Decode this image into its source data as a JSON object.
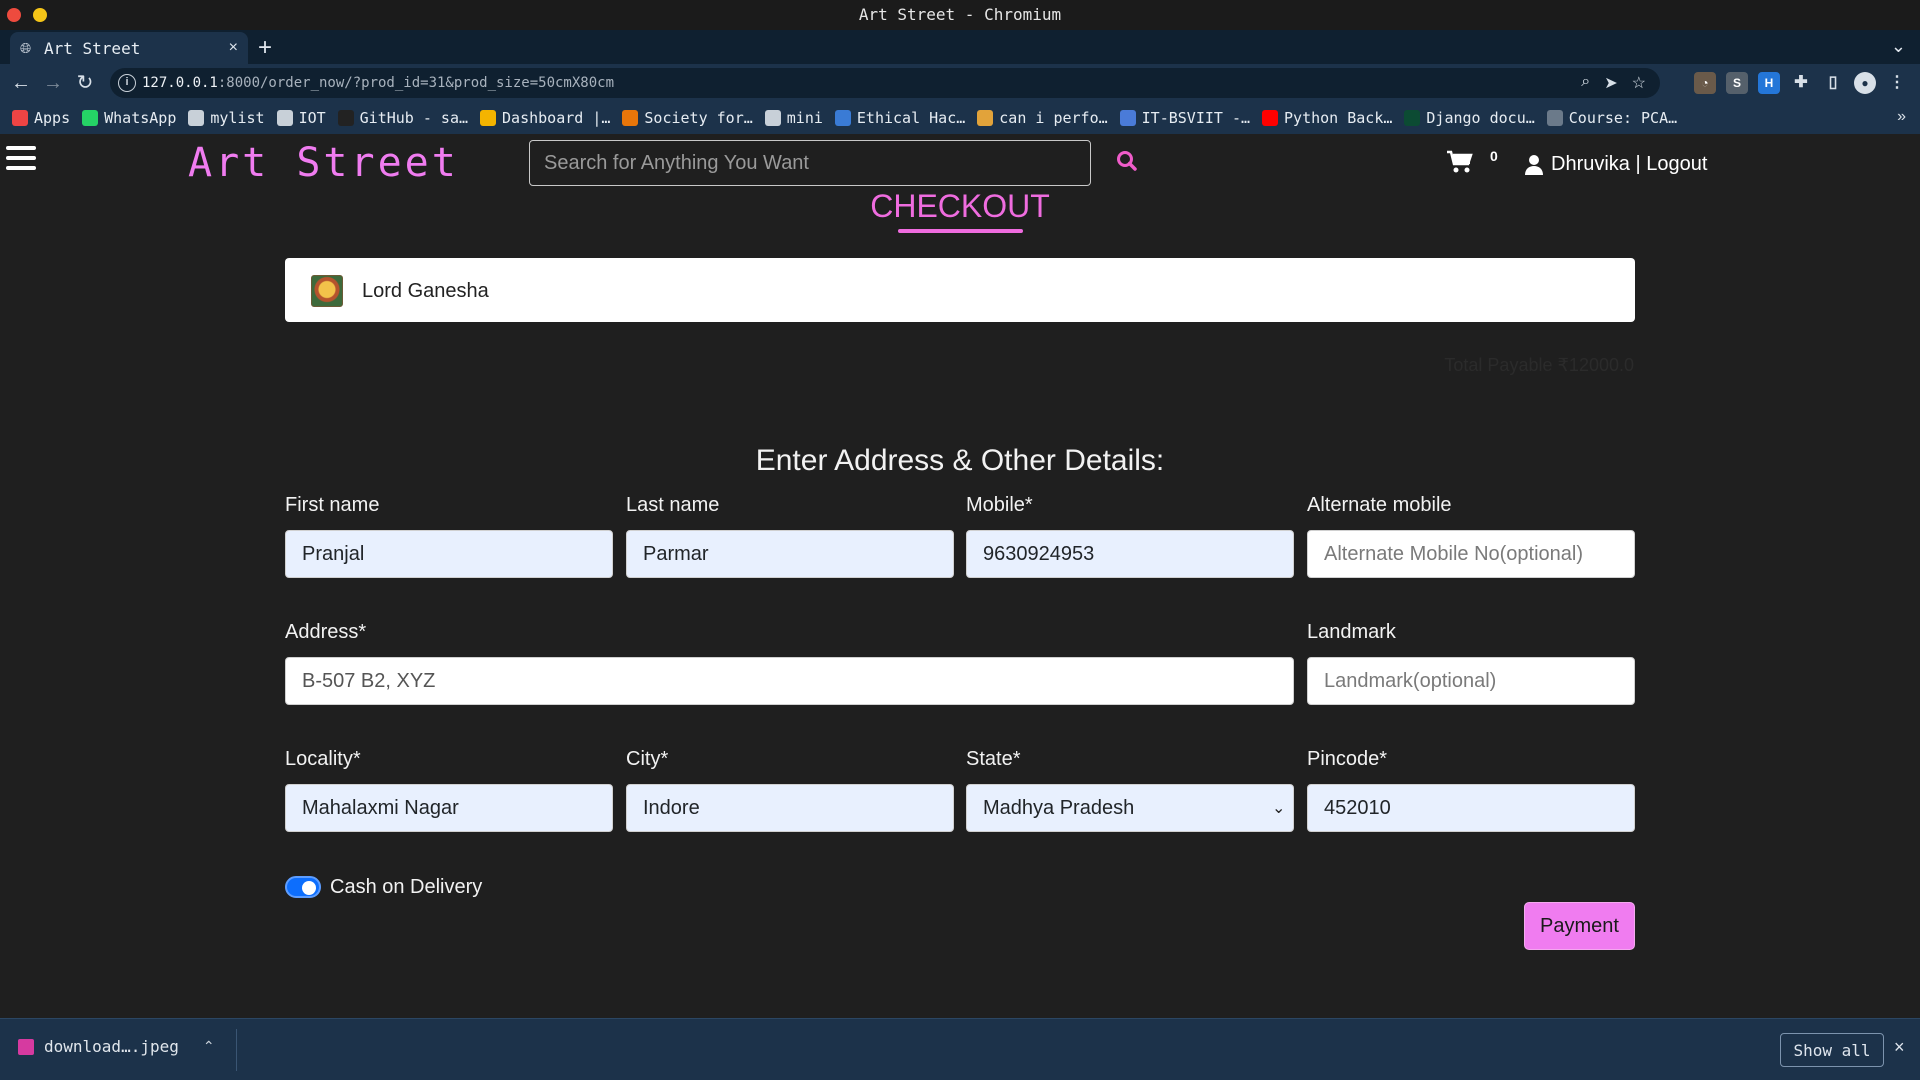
{
  "window": {
    "title": "Art Street - Chromium"
  },
  "tab": {
    "title": "Art Street",
    "close": "×",
    "new_tab": "+",
    "menu": "⌄"
  },
  "omnibox": {
    "host": "127.0.0.1",
    "rest": ":8000/order_now/?prod_id=31&prod_size=50cmX80cm"
  },
  "bookmarks": [
    {
      "label": "Apps",
      "icon": "apps-grid-icon",
      "color": "#e44"
    },
    {
      "label": "WhatsApp",
      "icon": "whatsapp-icon",
      "color": "#25d366"
    },
    {
      "label": "mylist",
      "icon": "folder-icon",
      "color": "#c8d0d8"
    },
    {
      "label": "IOT",
      "icon": "folder-icon",
      "color": "#c8d0d8"
    },
    {
      "label": "GitHub - sa…",
      "icon": "github-icon",
      "color": "#222"
    },
    {
      "label": "Dashboard |…",
      "icon": "dashboard-icon",
      "color": "#f4b400"
    },
    {
      "label": "Society for…",
      "icon": "society-icon",
      "color": "#e8760a"
    },
    {
      "label": "mini",
      "icon": "folder-icon",
      "color": "#c8d0d8"
    },
    {
      "label": "Ethical Hac…",
      "icon": "ethical-hacking-icon",
      "color": "#3a7bd5"
    },
    {
      "label": "can i perfo…",
      "icon": "stackexchange-icon",
      "color": "#e2a33a"
    },
    {
      "label": "IT-BSVIIT -…",
      "icon": "classroom-icon",
      "color": "#4a7bd8"
    },
    {
      "label": "Python Back…",
      "icon": "youtube-icon",
      "color": "#ff0000"
    },
    {
      "label": "Django docu…",
      "icon": "django-icon",
      "color": "#0c4b33"
    },
    {
      "label": "Course: PCA…",
      "icon": "course-icon",
      "color": "#6b7a8a"
    }
  ],
  "bookmarks_more": "»",
  "header": {
    "logo": "Art Street",
    "search_placeholder": "Search for Anything You Want",
    "cart_count": "0",
    "user_text": "Dhruvika | Logout"
  },
  "checkout": {
    "title": "CHECKOUT",
    "product_name": "Lord Ganesha",
    "total_payable": "Total Payable ₹12000.0"
  },
  "form": {
    "title": "Enter Address & Other Details:",
    "first_name": {
      "label": "First name",
      "value": "Pranjal"
    },
    "last_name": {
      "label": "Last name",
      "value": "Parmar"
    },
    "mobile": {
      "label": "Mobile*",
      "value": "9630924953"
    },
    "alt_mobile": {
      "label": "Alternate mobile",
      "placeholder": "Alternate Mobile No(optional)"
    },
    "address": {
      "label": "Address*",
      "placeholder": "B-507 B2, XYZ"
    },
    "landmark": {
      "label": "Landmark",
      "placeholder": "Landmark(optional)"
    },
    "locality": {
      "label": "Locality*",
      "value": "Mahalaxmi Nagar"
    },
    "city": {
      "label": "City*",
      "value": "Indore"
    },
    "state": {
      "label": "State*",
      "value": "Madhya Pradesh"
    },
    "pincode": {
      "label": "Pincode*",
      "value": "452010"
    },
    "cod": {
      "label": "Cash on Delivery",
      "checked": true
    },
    "payment_button": "Payment"
  },
  "downloads": {
    "file": "download….jpeg",
    "show_all": "Show all",
    "close": "×"
  },
  "colors": {
    "accent_pink": "#f07cf0",
    "checkout_pink": "#ef6cdf",
    "toggle_blue": "#0d6efd",
    "page_bg": "#1f1f1f"
  }
}
